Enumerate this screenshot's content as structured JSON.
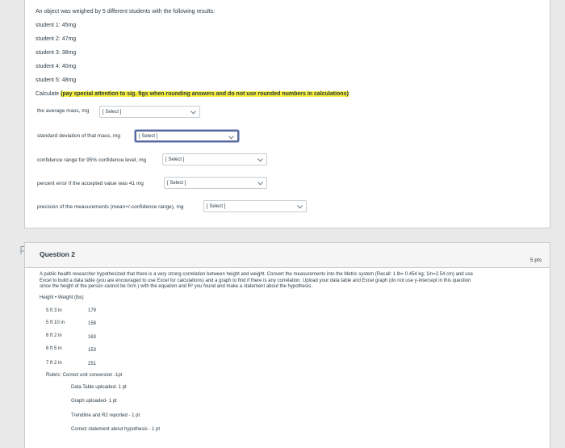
{
  "question1": {
    "intro": "An object was weighed by 5 different students with the following results:",
    "students": [
      "student 1: 45mg",
      "student 2: 47mg",
      "student 3: 38mg",
      "student 4: 40mg",
      "student 5: 48mg"
    ],
    "calculate_prefix": "Calculate ",
    "calculate_highlight": "(pay special attention to sig. figs when rounding answers and do not use rounded numbers in calculations)",
    "calculate_suffix": ":",
    "fields": [
      {
        "label": "the average mass, mg",
        "value": "[ Select ]"
      },
      {
        "label": "standard deviation of that mass, mg",
        "value": "[ Select ]"
      },
      {
        "label": "confidence range for 95% confidence level, mg",
        "value": "[ Select ]"
      },
      {
        "label": "percent error if the accepted value was 41 mg",
        "value": "[ Select ]"
      },
      {
        "label": "precision of the measurements (mean+/-confidence range), mg",
        "value": "[ Select ]"
      }
    ]
  },
  "question2": {
    "title": "Question 2",
    "points": "5 pts",
    "para_a": "A public health researcher hypothesized that there is a very strong correlation between height and weight. Convert the measurements into the Metric system (Recall: 1 lb= 0.454 kg; 1in=2.54 cm) and use",
    "para_b": "Excel to build a data table (you are encouraged to use Excel for calculations) and a graph to find if there is any correlation. Upload your data table and  Excel graph (do not use y-intercept in this question",
    "para_c": "since the height of the person cannot be 0cm ) with the equation and R² you found and make a statement about the hypothesis.",
    "table_header": "Height • Weight (lbs)",
    "rows": [
      {
        "height": "5 ft 3 in",
        "weight": "179"
      },
      {
        "height": "5 ft 10 in",
        "weight": "158"
      },
      {
        "height": "6 ft 2 in",
        "weight": "163"
      },
      {
        "height": "6 ft 5 in",
        "weight": "153"
      },
      {
        "height": "7 ft 2 in",
        "weight": "251"
      }
    ],
    "rubric_title": "Rubric: Correct unit conversion -1pt",
    "rubric_items": [
      "Data Table uploaded- 1 pt",
      "Graph uploaded- 1 pt",
      "Trendline and R2 reported - 1 pt",
      "Correct statement about hypothesis - 1 pt"
    ]
  }
}
